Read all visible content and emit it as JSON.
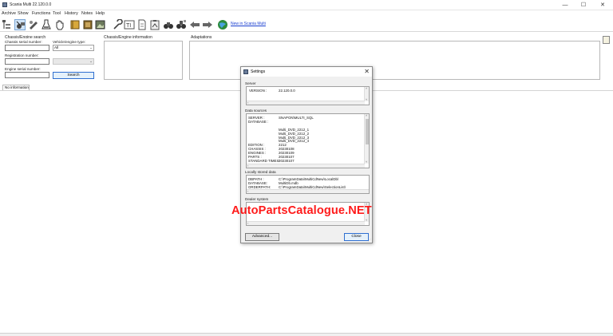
{
  "window": {
    "title": "Scania Multi    22.120.0.0",
    "minimize_glyph": "—",
    "maximize_glyph": "☐",
    "close_glyph": "✕"
  },
  "menu": [
    "Archive",
    "Show",
    "Functions",
    "Tool",
    "History",
    "Notes",
    "Help"
  ],
  "toolbar": {
    "icons": [
      "catalog-tree-icon",
      "engine-tools-icon",
      "wrench-puzzle-icon",
      "flask-icon",
      "hand-icon",
      "book-icon",
      "book-open-icon",
      "gallery-icon",
      "wrench-icon",
      "text-box-icon",
      "document-icon",
      "clipboard-icon",
      "binoculars-icon",
      "binoculars-tag-icon",
      "arrow-left-icon",
      "arrow-right-icon",
      "globe-icon"
    ],
    "link_text": "New in Scania Multi"
  },
  "search_panel": {
    "title": "Chassis/Engine search",
    "chassis_label": "Chassis serial number:",
    "chassis_value": "",
    "vehicle_type_label": "Vehicle/engine type:",
    "vehicle_type_value": "All",
    "registration_label": "Registration number:",
    "registration_value": "",
    "engine_label": "Engine serial number:",
    "engine_value": "",
    "search_button": "Search"
  },
  "info_panel": {
    "title": "Chassis/Engine information"
  },
  "adaptations_panel": {
    "title": "Adaptations"
  },
  "tabs": {
    "no_information": "No information"
  },
  "settings_dialog": {
    "title": "Settings",
    "server": {
      "label": "Server",
      "key": "VERSION :",
      "value": "22.120.0.0"
    },
    "data_sources": {
      "label": "Data sources",
      "rows": [
        {
          "key": "SERVER      :",
          "value": "SNAPON\\MULTI_SQL"
        },
        {
          "key": "DATABASE :",
          "value": ""
        },
        {
          "key": "",
          "value": ""
        },
        {
          "key": "",
          "value": "Multi_DVD_2212_1"
        },
        {
          "key": "",
          "value": "Multi_DVD_2212_2"
        },
        {
          "key": "",
          "value": "Multi_DVD_2212_3"
        },
        {
          "key": "",
          "value": "Multi_DVD_2212_4"
        },
        {
          "key": "EDITION      :",
          "value": "2212"
        },
        {
          "key": "CHASSIS      :",
          "value": "20230108"
        },
        {
          "key": "ENGINES      :",
          "value": "20230109"
        },
        {
          "key": "PARTS        :",
          "value": "20230107"
        },
        {
          "key": "STANDARD TIMES:",
          "value": "20230107"
        }
      ]
    },
    "local_data": {
      "label": "Locally stored data",
      "rows": [
        {
          "key": "DBPATH      :",
          "value": "C:\\ProgramData\\MultiCdNew\\LocalDb\\"
        },
        {
          "key": "DATABASE:",
          "value": "MultiDb.mdb"
        },
        {
          "key": "ORDERPATH:",
          "value": "C:\\ProgramData\\MultiCdNew\\SelectionList\\"
        }
      ]
    },
    "dealer": {
      "label": "Dealer system"
    },
    "advanced_button": "Advanced...",
    "close_button": "Close"
  },
  "watermark": "AutoPartsCatalogue.NET",
  "colors": {
    "link": "#1a3fd0",
    "watermark": "#ff1a1a",
    "primary_border": "#2f6fd0"
  }
}
